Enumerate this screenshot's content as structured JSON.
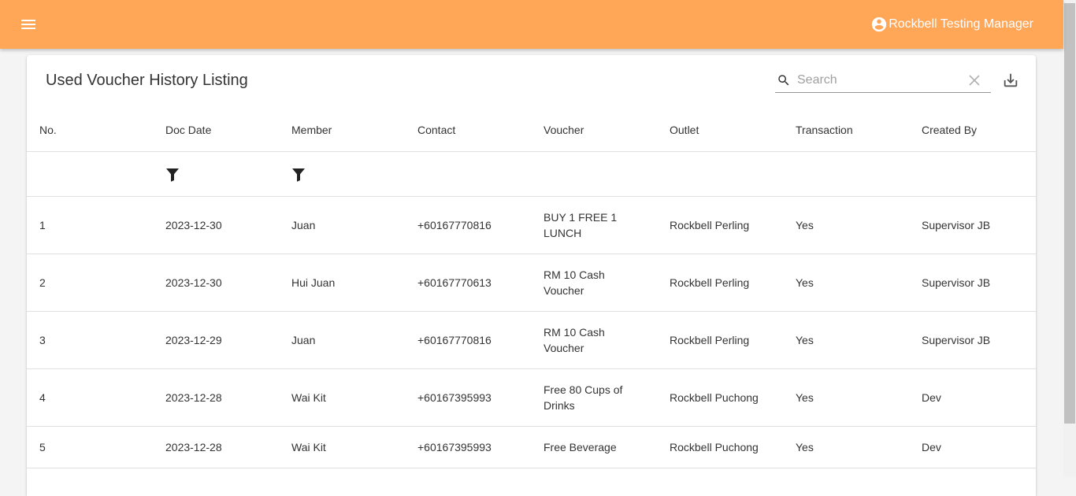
{
  "header": {
    "user_name": "Rockbell Testing Manager"
  },
  "page": {
    "title": "Used Voucher History Listing"
  },
  "search": {
    "placeholder": "Search",
    "value": ""
  },
  "table": {
    "columns": [
      "No.",
      "Doc Date",
      "Member",
      "Contact",
      "Voucher",
      "Outlet",
      "Transaction",
      "Created By"
    ],
    "rows": [
      {
        "no": "1",
        "doc_date": "2023-12-30",
        "member": "Juan",
        "contact": "+60167770816",
        "voucher": "BUY 1 FREE 1 LUNCH",
        "outlet": "Rockbell Perling",
        "transaction": "Yes",
        "created_by": "Supervisor JB"
      },
      {
        "no": "2",
        "doc_date": "2023-12-30",
        "member": "Hui Juan",
        "contact": "+60167770613",
        "voucher": "RM 10 Cash Voucher",
        "outlet": "Rockbell Perling",
        "transaction": "Yes",
        "created_by": "Supervisor JB"
      },
      {
        "no": "3",
        "doc_date": "2023-12-29",
        "member": "Juan",
        "contact": "+60167770816",
        "voucher": "RM 10 Cash Voucher",
        "outlet": "Rockbell Perling",
        "transaction": "Yes",
        "created_by": "Supervisor JB"
      },
      {
        "no": "4",
        "doc_date": "2023-12-28",
        "member": "Wai Kit",
        "contact": "+60167395993",
        "voucher": "Free 80 Cups of Drinks",
        "outlet": "Rockbell Puchong",
        "transaction": "Yes",
        "created_by": "Dev"
      },
      {
        "no": "5",
        "doc_date": "2023-12-28",
        "member": "Wai Kit",
        "contact": "+60167395993",
        "voucher": "Free Beverage",
        "outlet": "Rockbell Puchong",
        "transaction": "Yes",
        "created_by": "Dev"
      }
    ]
  },
  "icons": {
    "menu": "menu-icon",
    "account": "account-circle-icon",
    "search": "search-icon",
    "clear": "close-icon",
    "download": "download-icon",
    "filter": "filter-icon"
  },
  "colors": {
    "appbar": "#ffa657",
    "text": "#333333",
    "divider": "#e0e0e0"
  }
}
